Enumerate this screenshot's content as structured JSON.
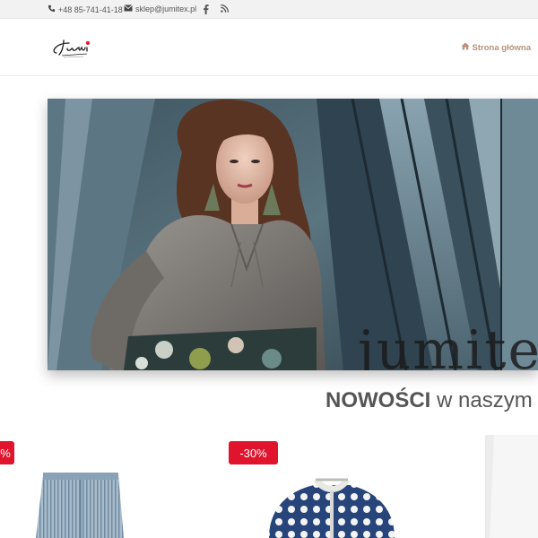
{
  "topbar": {
    "phone": "+48 85-741-41-18",
    "email": "sklep@jumitex.pl",
    "social": [
      "facebook-icon",
      "rss-icon"
    ]
  },
  "header": {
    "logo_text": "Jumi",
    "nav_home": "Strona główna"
  },
  "hero": {
    "brand_text": "jumite"
  },
  "section": {
    "title_bold": "NOWOŚCI",
    "title_rest": " w naszym"
  },
  "products": [
    {
      "badge": "%",
      "item": "striped-trousers"
    },
    {
      "badge": "-30%",
      "item": "polka-dot-jacket"
    },
    {
      "badge": "",
      "item": "white-garment"
    }
  ],
  "colors": {
    "badge": "#e0142d",
    "nav_accent": "#b8927a",
    "topbar_bg": "#f2f2f2"
  }
}
